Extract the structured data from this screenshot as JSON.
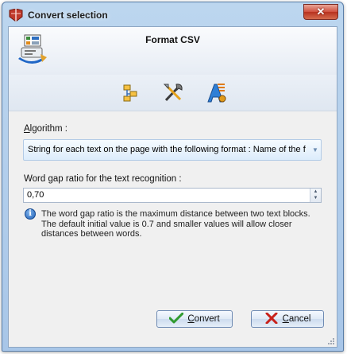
{
  "window": {
    "title": "Convert selection",
    "close_label": "✕"
  },
  "header": {
    "title": "Format CSV"
  },
  "toolbar": {
    "tools": [
      {
        "icon": "copy-layout-icon"
      },
      {
        "icon": "tools-icon"
      },
      {
        "icon": "text-format-icon"
      }
    ]
  },
  "algorithm": {
    "label_accel": "A",
    "label_rest": "lgorithm :",
    "selected": "String for each text on the page with the following format : Name of the f"
  },
  "word_gap": {
    "label": "Word gap ratio for the text recognition :",
    "value": "0,70"
  },
  "info": {
    "text": "The word gap ratio is the maximum distance between two text blocks. The default initial value is 0.7 and smaller values will allow closer distances between words."
  },
  "buttons": {
    "convert_accel": "C",
    "convert_rest": "onvert",
    "cancel_accel": "C",
    "cancel_rest": "ancel"
  },
  "colors": {
    "title_bar": "#bcd6ef",
    "client_bg": "#f0f0f0",
    "close_button": "#c8472f",
    "check_green": "#2f9a2f",
    "cancel_red": "#c8211b",
    "info_blue": "#1e5fb6"
  }
}
